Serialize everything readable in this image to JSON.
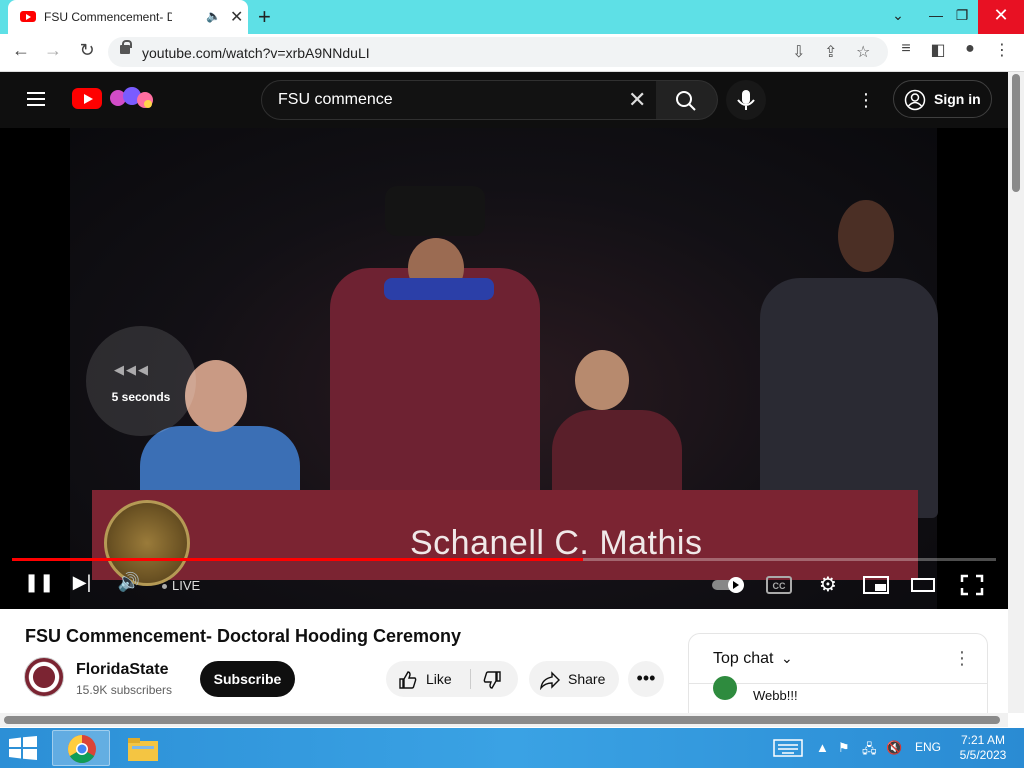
{
  "browser": {
    "tab_title": "FSU Commencement- Doctoral Hooding Ceremony - YouTube",
    "url": "youtube.com/watch?v=xrbA9NNduLI",
    "new_tab_icon": "plus-icon"
  },
  "youtube": {
    "search_query": "FSU commence",
    "sign_in_label": "Sign in"
  },
  "player": {
    "seek_overlay_text": "5 seconds",
    "nameplate_text": "Schanell C. Mathis",
    "live_label": "LIVE",
    "progress_fraction": 0.58
  },
  "video_info": {
    "title": "FSU Commencement- Doctoral Hooding Ceremony",
    "channel_name": "FloridaState",
    "subscribers": "15.9K subscribers",
    "subscribe_label": "Subscribe",
    "like_label": "Like",
    "share_label": "Share"
  },
  "chat": {
    "header": "Top chat",
    "partial_message": "Webb!!!"
  },
  "taskbar": {
    "language": "ENG",
    "time": "7:21 AM",
    "date": "5/5/2023"
  },
  "colors": {
    "tabbar_bg": "#5ee0e6",
    "youtube_red": "#ff0000",
    "fsu_garnet": "#7b2432",
    "taskbar_blue": "#2c8fd6"
  }
}
